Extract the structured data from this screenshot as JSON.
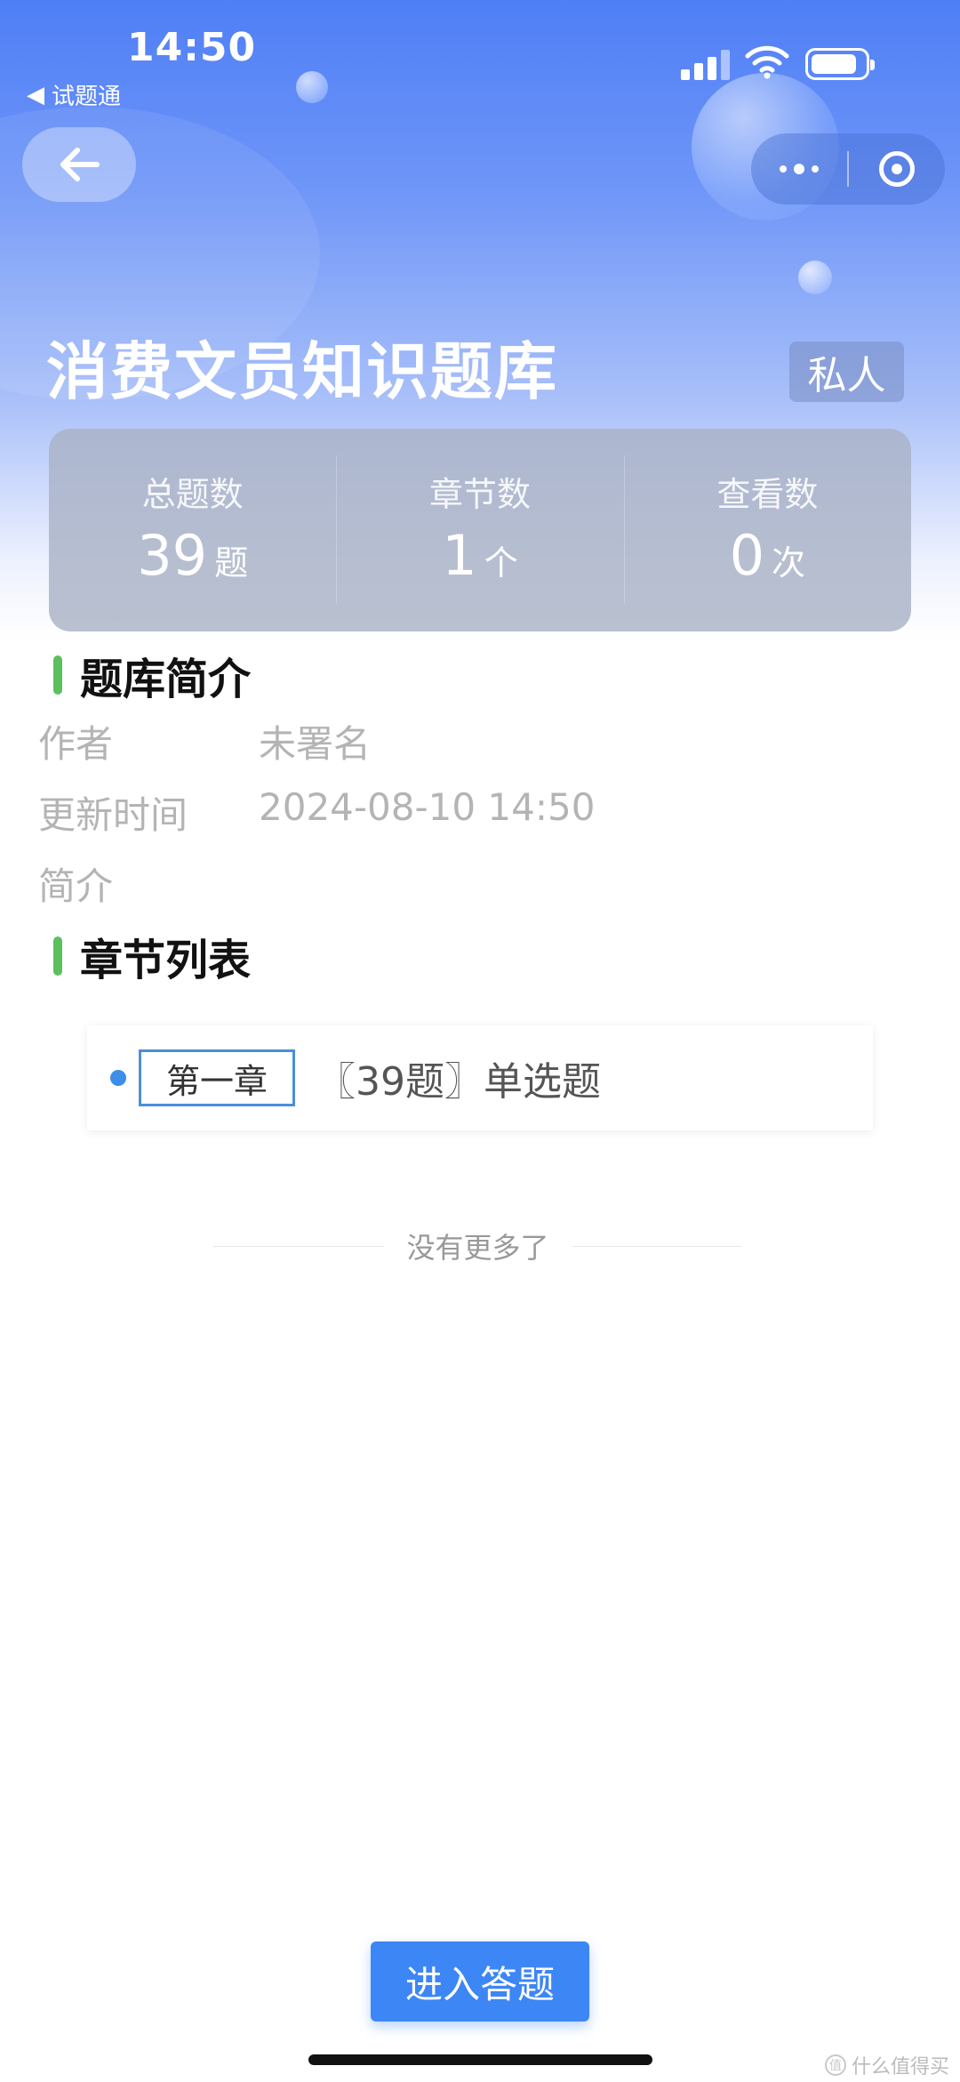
{
  "status_bar": {
    "time": "14:50",
    "back_app": "试题通"
  },
  "header": {
    "title": "消费文员知识题库",
    "tag": "私人"
  },
  "stats": [
    {
      "label": "总题数",
      "value": "39",
      "unit": "题"
    },
    {
      "label": "章节数",
      "value": "1",
      "unit": "个"
    },
    {
      "label": "查看数",
      "value": "0",
      "unit": "次"
    }
  ],
  "intro": {
    "heading": "题库简介",
    "rows": [
      {
        "label": "作者",
        "value": "未署名"
      },
      {
        "label": "更新时间",
        "value": "2024-08-10 14:50"
      },
      {
        "label": "简介",
        "value": ""
      }
    ]
  },
  "chapters": {
    "heading": "章节列表",
    "items": [
      {
        "name": "第一章",
        "meta": "〖39题〗单选题"
      }
    ],
    "no_more": "没有更多了"
  },
  "footer": {
    "enter_button": "进入答题",
    "watermark": "什么值得买"
  },
  "icons": {
    "back": "arrow-left-icon",
    "more": "more-dots-icon",
    "close": "target-icon",
    "signal": "cellular-signal-icon",
    "wifi": "wifi-icon",
    "battery": "battery-icon"
  },
  "colors": {
    "primary": "#3d86f5",
    "accent_green": "#5cc05f",
    "chapter_dot": "#3c8ee8"
  }
}
